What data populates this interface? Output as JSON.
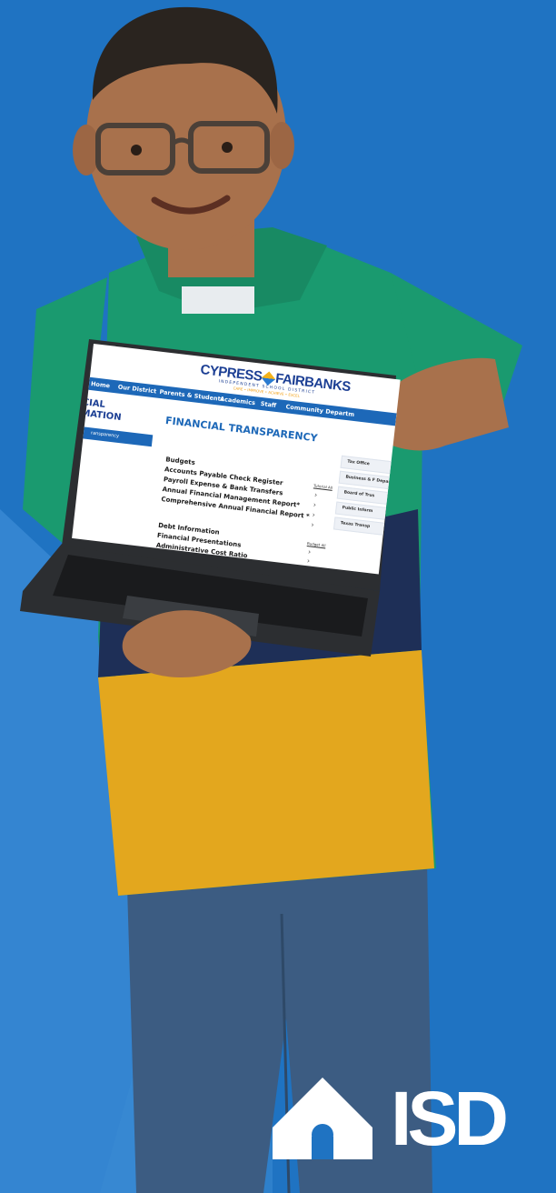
{
  "colors": {
    "background": "#1f73c2",
    "background_light": "#3a8ad4",
    "shirt_green": "#1a9a6f",
    "shirt_navy": "#1e2f57",
    "shirt_yellow": "#e3a71e",
    "jeans": "#3c5c82",
    "skin": "#a8714c",
    "hair": "#2a241f",
    "brand_blue": "#1c3f94",
    "brand_gold": "#f3b21b"
  },
  "laptop_screen": {
    "logo": {
      "left": "CYPRESS",
      "right": "FAIRBANKS",
      "subtitle": "INDEPENDENT SCHOOL DISTRICT",
      "tagline": "CARE • IMPROVE • ACHIEVE • EXCEL"
    },
    "nav": [
      "Home",
      "Our District",
      "Parents & Students",
      "Academics",
      "Staff",
      "Community",
      "Departm"
    ],
    "sidebar": {
      "title_line1": "CIAL",
      "title_line2": "MATION",
      "active_item": "ransparency"
    },
    "page_title": "FINANCIAL TRANSPARENCY",
    "section1": {
      "heading": "Budgets",
      "items": [
        "Accounts Payable Check Register",
        "Payroll Expense & Bank Transfers",
        "Annual Financial Management Report*",
        "Comprehensive Annual Financial Report *"
      ],
      "link": "Tutorial All"
    },
    "section2": {
      "items": [
        "Debt Information",
        "Financial Presentations",
        "Administrative Cost Ratio"
      ],
      "link": "Budget All"
    },
    "right_panel": [
      "Tax Office",
      "Business & F Departments",
      "Board of Trus",
      "Public Inform",
      "Texas Transp"
    ]
  },
  "brand": {
    "letters": "ISD"
  }
}
